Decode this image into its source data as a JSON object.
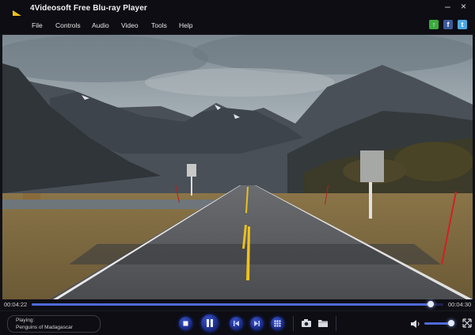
{
  "app": {
    "title": "4Videosoft Free Blu-ray Player"
  },
  "window_buttons": [
    "–",
    "×"
  ],
  "menu": {
    "items": [
      "File",
      "Controls",
      "Audio",
      "Video",
      "Tools",
      "Help"
    ]
  },
  "share_icons": [
    "upload-icon",
    "facebook-icon",
    "twitter-icon"
  ],
  "playback": {
    "current_time": "00:04:22",
    "total_time": "00:04:30",
    "progress": 0.97,
    "playing_label": "Playing:",
    "title": "Penguins of Madagascar",
    "volume": 0.9
  },
  "controls": [
    "stop-icon",
    "pause-icon",
    "previous-icon",
    "next-icon",
    "playlist-icon",
    "snapshot-icon",
    "open-folder-icon",
    "volume-icon",
    "fullscreen-icon"
  ],
  "colors": {
    "accent": "#3b55d0",
    "background": "#0d0d13",
    "text": "#e6e6e6"
  }
}
